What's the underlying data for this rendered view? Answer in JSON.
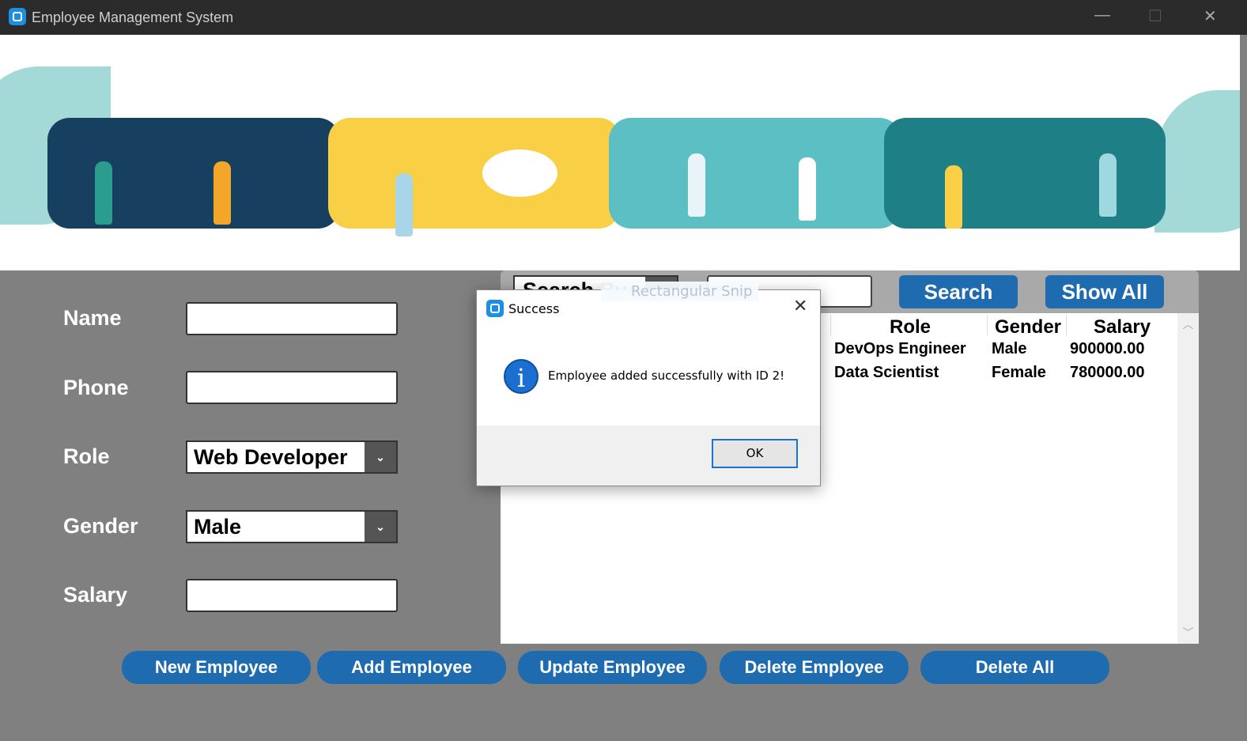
{
  "window": {
    "title": "Employee Management System",
    "minimize": "—",
    "maximize": "☐",
    "close": "✕"
  },
  "form": {
    "name_label": "Name",
    "phone_label": "Phone",
    "role_label": "Role",
    "gender_label": "Gender",
    "salary_label": "Salary",
    "name_value": "",
    "phone_value": "",
    "salary_value": "",
    "role_value": "Web Developer",
    "gender_value": "Male"
  },
  "search": {
    "by_label": "Search By",
    "value": "",
    "search_button": "Search",
    "show_all_button": "Show All",
    "overlay_text": "Rectangular Snip"
  },
  "table": {
    "columns": [
      "Role",
      "Gender",
      "Salary"
    ],
    "rows": [
      [
        "DevOps Engineer",
        "Male",
        "900000.00"
      ],
      [
        "Data Scientist",
        "Female",
        "780000.00"
      ]
    ]
  },
  "buttons": {
    "new": "New Employee",
    "add": "Add Employee",
    "update": "Update Employee",
    "delete": "Delete Employee",
    "delete_all": "Delete All"
  },
  "dialog": {
    "title": "Success",
    "message": "Employee added successfully with ID 2!",
    "ok": "OK",
    "icon": "info-icon"
  },
  "colors": {
    "accent": "#1f6bb0",
    "background": "#808080"
  }
}
